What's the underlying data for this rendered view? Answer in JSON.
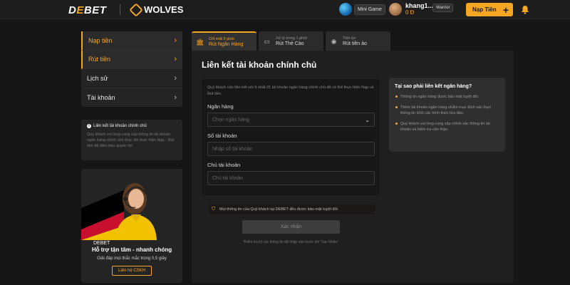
{
  "header": {
    "logo_part1": "D",
    "logo_part2": "E",
    "logo_part3": "BET",
    "partner_logo": "WOLVES",
    "mini_game_label": "Mini Game",
    "username": "khang1...",
    "balance": "0 Đ",
    "rank_badge": "Warrior",
    "deposit_button": "Nạp Tiền",
    "icons": [
      "globe-icon",
      "avatar",
      "bell-icon",
      "plus-icon"
    ]
  },
  "sidebar": {
    "items": [
      {
        "label": "Nạp tiền",
        "active": true
      },
      {
        "label": "Rút tiền",
        "active": true
      },
      {
        "label": "Lịch sử",
        "active": false
      },
      {
        "label": "Tài khoản",
        "active": false
      }
    ],
    "info_title": "Liên kết tài khoản chính chủ",
    "info_text": "Quý khách vui lòng cung cấp thông tin tài khoản ngân hàng chính chủ thực khi thực hiện Nạp - Rút tiền để đảm bảo quyền lợi."
  },
  "promo": {
    "brand": "DEBET",
    "title": "Hỗ trợ tận tâm - nhanh chóng",
    "subtitle": "Giải đáp mọi thắc mắc trong 0,5 giây",
    "button": "Liên hệ CSKH"
  },
  "tabs": [
    {
      "sub": "Chỉ mất 5 phút",
      "label": "Rút Ngân Hàng",
      "icon": "bank-icon",
      "active": true
    },
    {
      "sub": "Xử lý trong 1 phút",
      "label": "Rút Thẻ Cào",
      "icon": "card-icon",
      "active": false
    },
    {
      "sub": "Tiện lợi",
      "label": "Rút tiền ảo",
      "icon": "coin-icon",
      "active": false
    }
  ],
  "main": {
    "title": "Liên kết tài khoản chính chủ",
    "description": "Quý khách cần liên kết với ít nhất 01 tài khoản ngân hàng chính chủ để có thể thực hiện Nạp và Rút tiền.",
    "bank_label": "Ngân hàng",
    "bank_placeholder": "Chọn ngân hàng",
    "account_number_label": "Số tài khoản",
    "account_number_placeholder": "Nhập số tài khoản",
    "account_holder_label": "Chủ tài khoản",
    "account_holder_placeholder": "Chủ tài khoản",
    "security_note": "Mọi thông tin của Quý khách tại DEBET đều được bảo mật tuyệt đối",
    "confirm_button": "Xác nhận",
    "confirm_note": "*Kiểm tra kỹ các thông tin đã nhập vào trước khi \"Xác Nhận\""
  },
  "why": {
    "title": "Tại sao phải liên kết ngân hàng?",
    "items": [
      "Thông tin ngân hàng được bảo mật tuyệt đối.",
      "Thêm tài khoản ngân hàng nhằm mục đích xác thực thông tin khỏi các hình thức lừa đảo.",
      "Quý khách vui lòng cung cấp chính xác thông tin tài khoản và kiểm tra cẩn thận."
    ]
  },
  "colors": {
    "accent": "#f5a623",
    "background": "#151515",
    "panel": "#1f1f1f"
  }
}
